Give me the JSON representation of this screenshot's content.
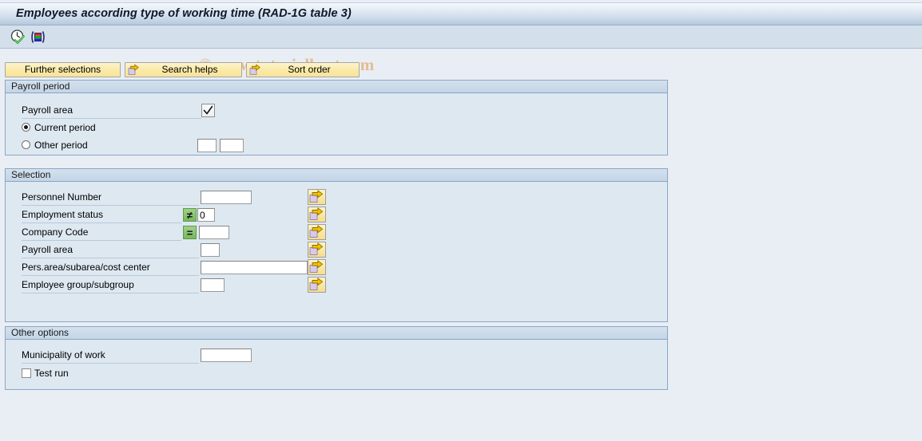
{
  "window": {
    "title": "Employees according type of working time (RAD-1G table 3)"
  },
  "toolbar": {
    "icons": [
      {
        "name": "clock-check-icon",
        "title": "Execute"
      },
      {
        "name": "color-bars-icon",
        "title": "Variants"
      }
    ]
  },
  "watermark": {
    "text": "© www.tutorialkart.com",
    "color": "#e5bd91"
  },
  "buttons": {
    "further_selections": "Further selections",
    "search_helps": "Search helps",
    "sort_order": "Sort order"
  },
  "panels": {
    "payroll_period": {
      "title": "Payroll period",
      "payroll_area_label": "Payroll area",
      "payroll_area_value": "",
      "current_period_label": "Current period",
      "current_period_selected": true,
      "other_period_label": "Other period",
      "other_period_selected": false,
      "other_period_value_1": "",
      "other_period_value_2": ""
    },
    "selection": {
      "title": "Selection",
      "rows": [
        {
          "label": "Personnel Number",
          "operator": "",
          "value": "",
          "field_width": 64
        },
        {
          "label": "Employment status",
          "operator": "≠",
          "value": "0",
          "field_width": 22
        },
        {
          "label": "Company Code",
          "operator": "=",
          "value": "",
          "field_width": 38
        },
        {
          "label": "Payroll area",
          "operator": "",
          "value": "",
          "field_width": 24
        },
        {
          "label": "Pers.area/subarea/cost center",
          "operator": "",
          "value": "",
          "field_width": 134
        },
        {
          "label": "Employee group/subgroup",
          "operator": "",
          "value": "",
          "field_width": 30
        }
      ]
    },
    "other_options": {
      "title": "Other options",
      "municipality_label": "Municipality of work",
      "municipality_value": "",
      "test_run_label": "Test run",
      "test_run_checked": false
    }
  },
  "colors": {
    "page_background": "#e9eef5",
    "panel_background": "#dee8f1",
    "panel_border": "#8aa6c4",
    "title_gradient_top": "#f4f8fc",
    "title_gradient_bottom": "#a8bcd4",
    "toolbar_background": "#d3dfeb",
    "button_yellow": "#fbeaa8",
    "operator_green": "#77b85e"
  }
}
